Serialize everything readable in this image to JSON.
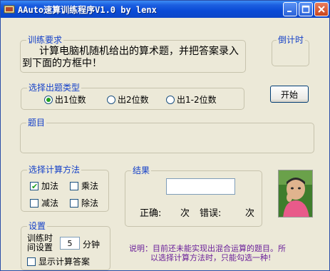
{
  "window": {
    "title": "AAuto速算训练程序V1.0 by lenx"
  },
  "instructions": {
    "title": "训练要求",
    "text": "计算电脑机随机给出的算术题，并把答案录入到下面的方框中！"
  },
  "countdown": {
    "title": "倒计时"
  },
  "question_type": {
    "title": "选择出题类型",
    "options": [
      "出1位数",
      "出2位数",
      "出1-2位数"
    ],
    "selected": "出1位数"
  },
  "start_button": {
    "label": "开始"
  },
  "question": {
    "title": "题目"
  },
  "operations": {
    "title": "选择计算方法",
    "items": [
      {
        "label": "加法",
        "checked": true
      },
      {
        "label": "乘法",
        "checked": false
      },
      {
        "label": "减法",
        "checked": false
      },
      {
        "label": "除法",
        "checked": false
      }
    ]
  },
  "result": {
    "title": "结果",
    "answer_value": "",
    "correct_label": "正确:",
    "correct_unit": "次",
    "wrong_label": "错误:",
    "wrong_unit": "次"
  },
  "settings": {
    "title": "设置",
    "time_label_line1": "训练时",
    "time_label_line2": "间设置",
    "time_value": "5",
    "time_unit": "分钟",
    "show_answer_label": "显示计算答案",
    "show_answer_checked": false
  },
  "note": {
    "line1": "说明：目前还未能实现出混合运算的题目。所",
    "line2": "以选择计算方法时，只能勾选一种!"
  },
  "colors": {
    "title_bar": "#0a4ad6",
    "group_label": "#1440c8",
    "note_text": "#6a1f9a",
    "check_green": "#21a121"
  }
}
